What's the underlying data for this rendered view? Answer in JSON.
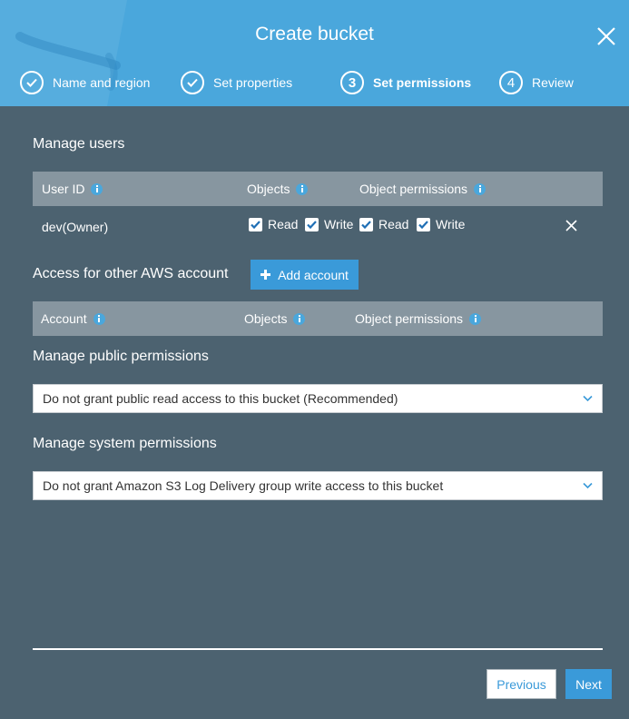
{
  "header": {
    "title": "Create bucket"
  },
  "steps": [
    {
      "number": "",
      "label": "Name and region",
      "state": "done"
    },
    {
      "number": "",
      "label": "Set properties",
      "state": "done"
    },
    {
      "number": "3",
      "label": "Set permissions",
      "state": "active"
    },
    {
      "number": "4",
      "label": "Review",
      "state": "pending"
    }
  ],
  "manage_users": {
    "title": "Manage users",
    "columns": [
      "User ID",
      "Objects",
      "Object permissions"
    ],
    "rows": [
      {
        "user_id": "dev(Owner)",
        "objects_read": {
          "label": "Read",
          "checked": true
        },
        "objects_write": {
          "label": "Write",
          "checked": true
        },
        "perm_read": {
          "label": "Read",
          "checked": true
        },
        "perm_write": {
          "label": "Write",
          "checked": true
        }
      }
    ]
  },
  "other_accounts": {
    "title": "Access for other AWS account",
    "add_label": "Add account",
    "columns": [
      "Account",
      "Objects",
      "Object permissions"
    ]
  },
  "public_permissions": {
    "title": "Manage public permissions",
    "selected": "Do not grant public read access to this bucket (Recommended)"
  },
  "system_permissions": {
    "title": "Manage system permissions",
    "selected": "Do not grant Amazon S3 Log Delivery group write access to this bucket"
  },
  "footer": {
    "previous_label": "Previous",
    "next_label": "Next"
  },
  "colors": {
    "header": "#4aa7dc",
    "body": "#4c6270",
    "table_header": "#8796a0",
    "accent": "#3a9ad9"
  },
  "icons": [
    "check-icon",
    "close-icon",
    "info-icon",
    "plus-icon",
    "chevron-down-icon",
    "remove-icon"
  ]
}
